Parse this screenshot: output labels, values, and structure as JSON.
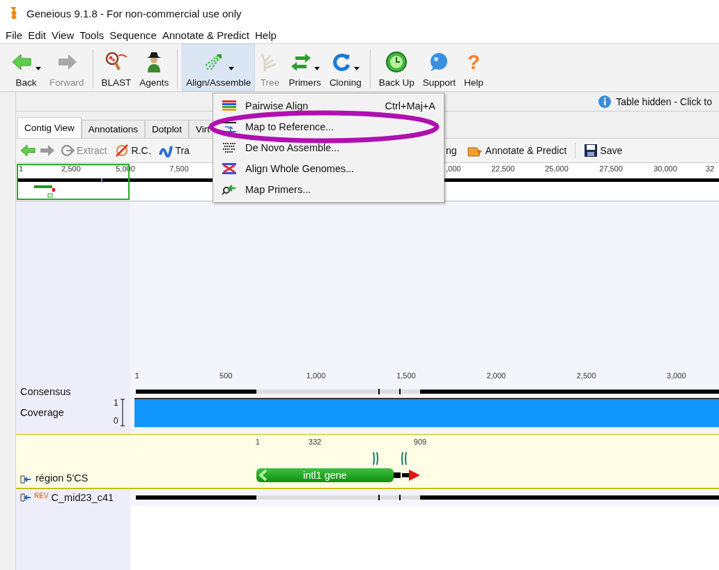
{
  "window": {
    "title": "Geneious 9.1.8 - For non-commercial use only"
  },
  "menu_bar": [
    "File",
    "Edit",
    "View",
    "Tools",
    "Sequence",
    "Annotate & Predict",
    "Help"
  ],
  "toolbar": [
    [
      {
        "label": "Back",
        "kind": "back",
        "disabled": false,
        "selected": false,
        "dropdown": true
      },
      {
        "label": "Forward",
        "kind": "forward",
        "disabled": true,
        "selected": false,
        "dropdown": false
      }
    ],
    [
      {
        "label": "BLAST",
        "kind": "blast",
        "disabled": false,
        "selected": false,
        "dropdown": false
      },
      {
        "label": "Agents",
        "kind": "agents",
        "disabled": false,
        "selected": false,
        "dropdown": false
      }
    ],
    [
      {
        "label": "Align/Assemble",
        "kind": "align",
        "disabled": false,
        "selected": true,
        "dropdown": true
      },
      {
        "label": "Tree",
        "kind": "tree",
        "disabled": true,
        "selected": false,
        "dropdown": false
      },
      {
        "label": "Primers",
        "kind": "primers",
        "disabled": false,
        "selected": false,
        "dropdown": true
      },
      {
        "label": "Cloning",
        "kind": "cloning",
        "disabled": false,
        "selected": false,
        "dropdown": true
      }
    ],
    [
      {
        "label": "Back Up",
        "kind": "backup",
        "disabled": false,
        "selected": false,
        "dropdown": false
      },
      {
        "label": "Support",
        "kind": "support",
        "disabled": false,
        "selected": false,
        "dropdown": false
      },
      {
        "label": "Help",
        "kind": "help",
        "glyph": "?",
        "disabled": false,
        "selected": false,
        "dropdown": false
      }
    ]
  ],
  "align_menu": [
    {
      "label": "Pairwise Align",
      "shortcut": "Ctrl+Maj+A",
      "kind": "pairwise",
      "circled": false
    },
    {
      "label": "Map to Reference...",
      "kind": "map",
      "circled": true
    },
    {
      "label": "De Novo Assemble...",
      "kind": "denovo",
      "circled": false
    },
    {
      "label": "Align Whole Genomes...",
      "kind": "genomes",
      "circled": false
    },
    {
      "label": "Map Primers...",
      "kind": "primers",
      "circled": false
    }
  ],
  "info_bar": {
    "text": "Table hidden - Click to"
  },
  "doc_tabs": [
    {
      "label": "Contig View",
      "selected": true
    },
    {
      "label": "Annotations",
      "selected": false
    },
    {
      "label": "Dotplot",
      "selected": false
    },
    {
      "label": "Virt",
      "selected": false
    }
  ],
  "view_toolbar": {
    "left": [
      {
        "kind": "back",
        "disabled": false
      },
      {
        "kind": "forward",
        "disabled": true
      },
      {
        "kind": "extract",
        "label": "Extract",
        "disabled": true
      },
      {
        "kind": "rc",
        "label": "R.C.",
        "disabled": false
      },
      {
        "kind": "translate",
        "label": "Tra",
        "disabled": false
      }
    ],
    "right": [
      {
        "kind": "plain",
        "label": "ng"
      },
      {
        "kind": "annotate",
        "label": "Annotate & Predict"
      },
      {
        "kind": "save",
        "label": "Save"
      }
    ]
  },
  "overview_ruler": [
    "1",
    "2,500",
    "5,000",
    "7,500",
    ",000",
    "22,500",
    "25,000",
    "27,500",
    "30,000",
    "32"
  ],
  "contig": {
    "ruler": [
      "1",
      "500",
      "1,000",
      "1,500",
      "2,000",
      "2,500",
      "3,000"
    ],
    "consensus_label": "Consensus",
    "coverage_label": "Coverage",
    "coverage_max": "1",
    "coverage_min": "0",
    "annotation_track": {
      "name": "région 5'CS",
      "ticks": [
        "1",
        "332",
        "909"
      ],
      "gene": "intl1 gene"
    },
    "read": {
      "strand": "REV",
      "name": "C_mid23_c41"
    }
  }
}
